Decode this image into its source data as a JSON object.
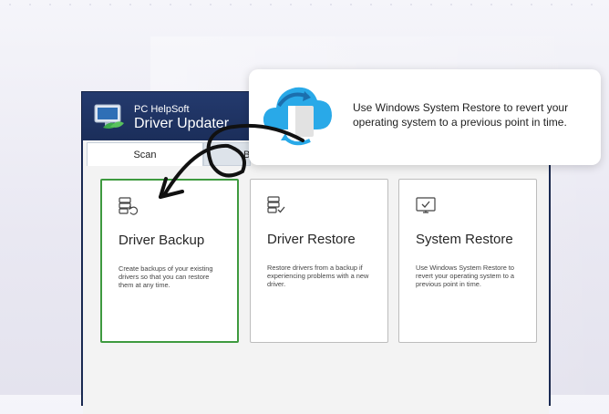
{
  "app": {
    "brand_small": "PC HelpSoft",
    "brand_big": "Driver Updater"
  },
  "tabs": [
    {
      "label": "Scan",
      "active": true
    },
    {
      "label": "B",
      "active": false
    }
  ],
  "cards": [
    {
      "title": "Driver Backup",
      "description": "Create backups of your existing drivers so that you can restore them at any time.",
      "icon": "driver-backup-icon",
      "selected": true
    },
    {
      "title": "Driver Restore",
      "description": "Restore drivers from a backup if experiencing problems with a new driver.",
      "icon": "driver-restore-icon",
      "selected": false
    },
    {
      "title": "System Restore",
      "description": "Use Windows System Restore to revert your operating system to a previous point in time.",
      "icon": "system-restore-icon",
      "selected": false
    }
  ],
  "tooltip": {
    "text": "Use Windows System Restore to revert your operating system to a previous point in time.",
    "icon": "cloud-restore-icon"
  },
  "colors": {
    "header": "#1d2f5b",
    "selected_border": "#3e9a3f",
    "cloud_blue": "#29a9e8"
  }
}
